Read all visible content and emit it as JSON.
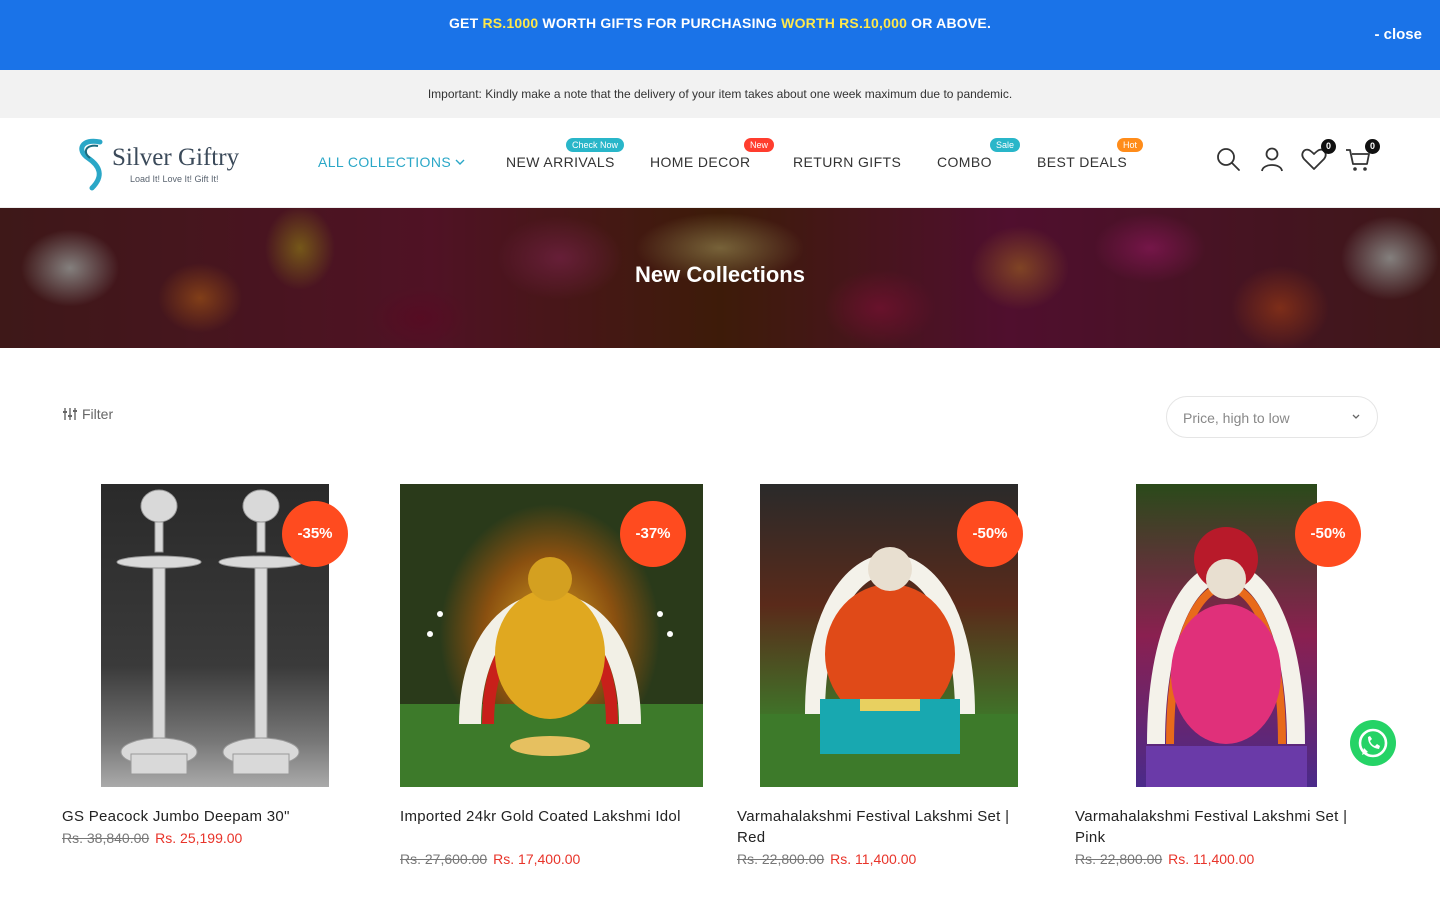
{
  "promo": {
    "part1": "GET ",
    "part2": "RS.1000",
    "part3": " WORTH GIFTS FOR PURCHASING ",
    "part4": "WORTH RS.10,000",
    "part5": " OR ABOVE.",
    "close_label": "- close",
    "colors": {
      "background": "#1a73e8",
      "highlight": "#ffe84a"
    }
  },
  "notice": {
    "text": "Important: Kindly make a note that the delivery of your item takes about one week maximum due to pandemic."
  },
  "header": {
    "logo": {
      "name": "Silver Giftry",
      "tagline": "Load It! Love It! Gift It!"
    },
    "nav": [
      {
        "label": "ALL COLLECTIONS",
        "active": true
      },
      {
        "label": "NEW ARRIVALS",
        "badge": "Check Now"
      },
      {
        "label": "HOME DECOR",
        "badge": "New"
      },
      {
        "label": "RETURN GIFTS"
      },
      {
        "label": "COMBO",
        "badge": "Sale"
      },
      {
        "label": "BEST DEALS",
        "badge": "Hot"
      }
    ],
    "icons": [
      "search-icon",
      "user-icon",
      "wishlist-icon",
      "cart-icon"
    ],
    "wishlist_count": "0",
    "cart_count": "0"
  },
  "hero": {
    "title": "New Collections"
  },
  "toolbar": {
    "filter_label": "Filter",
    "sort_label": "Price, high to low"
  },
  "products": [
    {
      "name": "GS Peacock Jumbo Deepam 30\"",
      "old_price": "Rs. 38,840.00",
      "price": "Rs. 25,199.00",
      "discount": "-35%"
    },
    {
      "name": "Imported 24kr Gold Coated Lakshmi Idol",
      "old_price": "Rs. 27,600.00",
      "price": "Rs. 17,400.00",
      "discount": "-37%"
    },
    {
      "name": "Varmahalakshmi Festival Lakshmi Set | Red",
      "old_price": "Rs. 22,800.00",
      "price": "Rs. 11,400.00",
      "discount": "-50%"
    },
    {
      "name": "Varmahalakshmi Festival Lakshmi Set | Pink",
      "old_price": "Rs. 22,800.00",
      "price": "Rs. 11,400.00",
      "discount": "-50%"
    }
  ],
  "accent_colors": {
    "nav_active": "#2aa7c7",
    "discount_badge": "#ff4b1f",
    "sale_price": "#e8342a",
    "whatsapp": "#25d366"
  }
}
